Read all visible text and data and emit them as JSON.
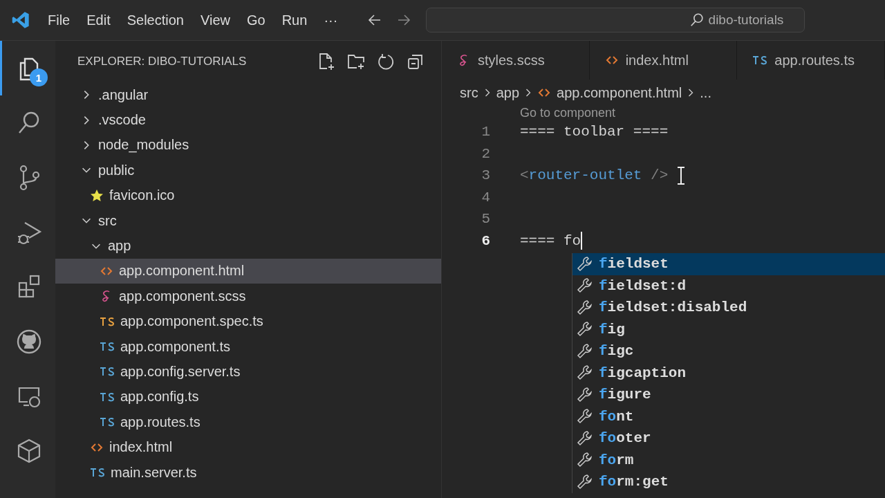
{
  "menu": [
    "File",
    "Edit",
    "Selection",
    "View",
    "Go",
    "Run",
    "···"
  ],
  "search": {
    "value": "dibo-tutorials"
  },
  "activity_bar": [
    {
      "kind": "explorer",
      "selected": true,
      "badge": "1"
    },
    {
      "kind": "search",
      "selected": false
    },
    {
      "kind": "source-control",
      "selected": false
    },
    {
      "kind": "run-debug",
      "selected": false
    },
    {
      "kind": "extensions",
      "selected": false
    },
    {
      "kind": "github",
      "selected": false
    },
    {
      "kind": "remote",
      "selected": false
    },
    {
      "kind": "cube",
      "selected": false
    }
  ],
  "sidebar": {
    "title": "EXPLORER: DIBO-TUTORIALS",
    "tree": [
      {
        "kind": "folder",
        "name": ".angular",
        "expanded": false
      },
      {
        "kind": "folder",
        "name": ".vscode",
        "expanded": false
      },
      {
        "kind": "folder",
        "name": "node_modules",
        "expanded": false
      },
      {
        "kind": "folder",
        "name": "public",
        "expanded": true,
        "children": [
          {
            "kind": "star",
            "name": "favicon.ico",
            "selected": false
          }
        ]
      },
      {
        "kind": "folder",
        "name": "src",
        "expanded": true,
        "children": [
          {
            "kind": "folder",
            "name": "app",
            "expanded": true,
            "children": [
              {
                "kind": "html",
                "name": "app.component.html",
                "selected": true
              },
              {
                "kind": "scss",
                "name": "app.component.scss",
                "selected": false
              },
              {
                "kind": "spec",
                "name": "app.component.spec.ts",
                "selected": false
              },
              {
                "kind": "ts",
                "name": "app.component.ts",
                "selected": false
              },
              {
                "kind": "ts",
                "name": "app.config.server.ts",
                "selected": false
              },
              {
                "kind": "ts",
                "name": "app.config.ts",
                "selected": false
              },
              {
                "kind": "ts",
                "name": "app.routes.ts",
                "selected": false
              }
            ]
          },
          {
            "kind": "html",
            "name": "index.html",
            "selected": false
          },
          {
            "kind": "ts",
            "name": "main.server.ts",
            "selected": false
          }
        ]
      }
    ]
  },
  "tabs": [
    {
      "kind": "scss",
      "label": "styles.scss",
      "selected": false
    },
    {
      "kind": "html",
      "label": "index.html",
      "selected": false
    },
    {
      "kind": "ts",
      "label": "app.routes.ts",
      "selected": false
    }
  ],
  "breadcrumb": [
    {
      "label": "src"
    },
    {
      "label": "app"
    },
    {
      "kind": "html",
      "label": "app.component.html"
    },
    {
      "label": "..."
    }
  ],
  "codelens": "Go to component",
  "lines": [
    {
      "number": "1",
      "current": false,
      "tokens": [
        {
          "kind": "text",
          "text": "==== toolbar ===="
        }
      ]
    },
    {
      "number": "2",
      "current": false
    },
    {
      "number": "3",
      "current": false,
      "tokens": [
        {
          "kind": "punct",
          "text": "<"
        },
        {
          "kind": "tag",
          "text": "router-outlet"
        },
        {
          "kind": "punct",
          "text": " />"
        }
      ]
    },
    {
      "number": "4",
      "current": false
    },
    {
      "number": "5",
      "current": false
    },
    {
      "number": "6",
      "current": true,
      "tokens": [
        {
          "kind": "text",
          "text": "==== fo"
        }
      ]
    }
  ],
  "suggestions": [
    {
      "match": "f",
      "rest": "ieldset",
      "selected": true
    },
    {
      "match": "f",
      "rest": "ieldset:d",
      "selected": false
    },
    {
      "match": "f",
      "rest": "ieldset:disabled",
      "selected": false
    },
    {
      "match": "f",
      "rest": "ig",
      "selected": false
    },
    {
      "match": "f",
      "rest": "igc",
      "selected": false
    },
    {
      "match": "f",
      "rest": "igcaption",
      "selected": false
    },
    {
      "match": "f",
      "rest": "igure",
      "selected": false
    },
    {
      "match": "fo",
      "rest": "nt",
      "selected": false
    },
    {
      "match": "fo",
      "rest": "oter",
      "selected": false
    },
    {
      "match": "fo",
      "rest": "rm",
      "selected": false
    },
    {
      "match": "fo",
      "rest": "rm:get",
      "selected": false
    }
  ]
}
